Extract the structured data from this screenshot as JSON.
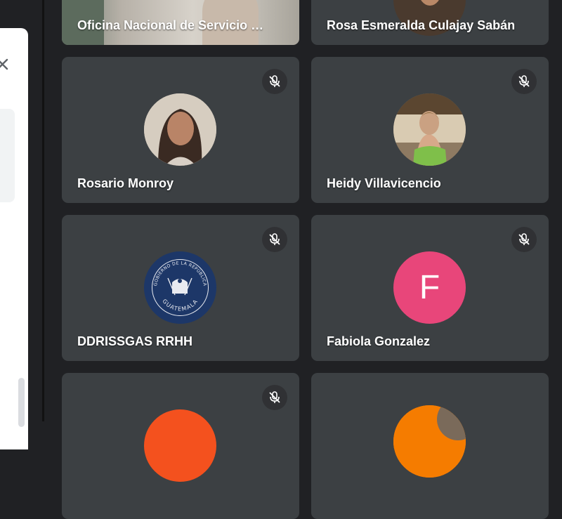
{
  "participants": [
    {
      "name": "Oficina Nacional de Servicio …",
      "muted": false,
      "avatar": "video"
    },
    {
      "name": "Rosa Esmeralda Culajay Sabán",
      "muted": false,
      "avatar": "photo"
    },
    {
      "name": "Rosario Monroy",
      "muted": true,
      "avatar": "photo"
    },
    {
      "name": "Heidy Villavicencio",
      "muted": true,
      "avatar": "photo"
    },
    {
      "name": "DDRISSGAS RRHH",
      "muted": true,
      "avatar": "logo"
    },
    {
      "name": "Fabiola Gonzalez",
      "muted": true,
      "avatar": "letter",
      "letter": "F",
      "color": "#e8467a"
    },
    {
      "name": "",
      "muted": true,
      "avatar": "letter",
      "color": "#f4511e"
    },
    {
      "name": "",
      "muted": false,
      "avatar": "photo"
    }
  ],
  "logo_text": {
    "top": "GOBIERNO DE LA REPÚBLICA",
    "bottom": "GUATEMALA"
  },
  "icons": {
    "close": "close-icon",
    "mic_off": "mic-off-icon"
  }
}
